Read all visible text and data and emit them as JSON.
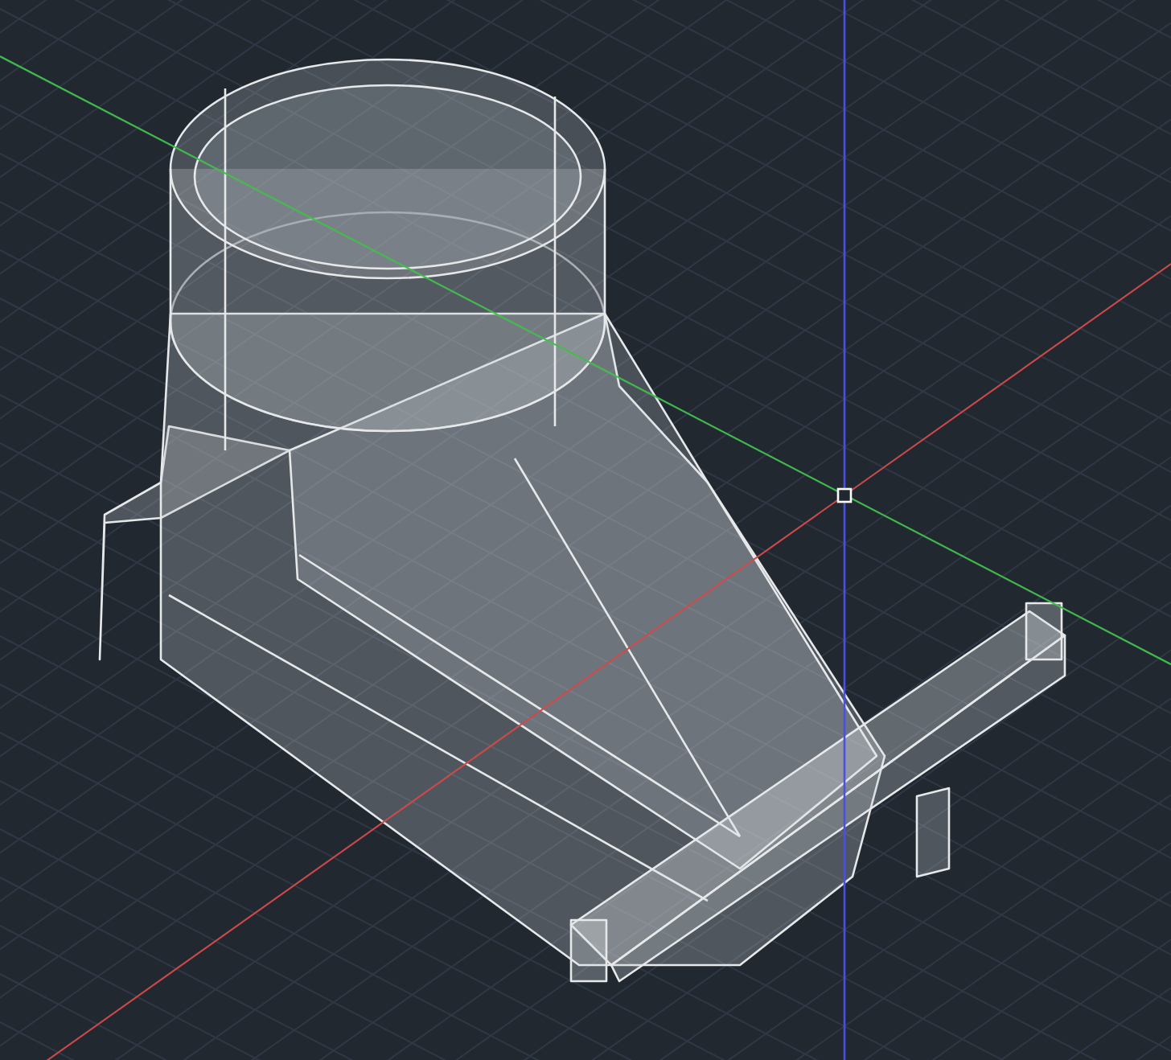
{
  "viewport": {
    "grid": true,
    "ucs_axes": true,
    "model_visible": true
  }
}
